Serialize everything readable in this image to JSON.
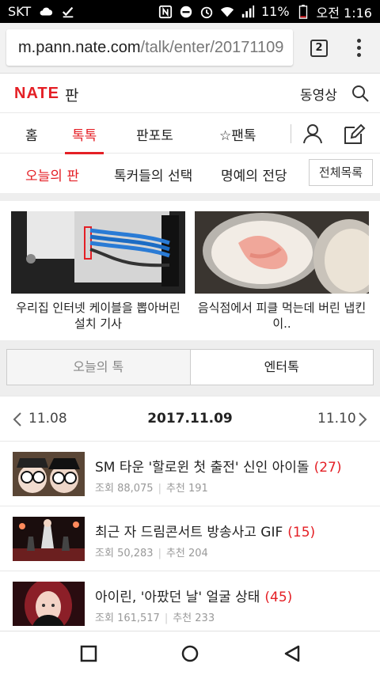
{
  "status_bar": {
    "carrier": "SKT",
    "battery": "11%",
    "time": "오전 1:16"
  },
  "browser": {
    "url_host": "m.pann.nate.com",
    "url_path": "/talk/enter/20171109",
    "tab_count": "2"
  },
  "header": {
    "logo": "NATE",
    "logo_sub": "판",
    "video_label": "동영상"
  },
  "main_nav": {
    "items": [
      "홈",
      "톡톡",
      "판포토",
      "☆팬톡"
    ],
    "active": "톡톡"
  },
  "sub_nav": {
    "items": [
      "오늘의 판",
      "톡커들의 선택",
      "명예의 전당"
    ],
    "all_button": "전체목록"
  },
  "featured": [
    {
      "caption": "우리집 인터넷 케이블을 뽑아버린 설치 기사"
    },
    {
      "caption": "음식점에서 피클 먹는데 버린 냅킨이.."
    }
  ],
  "toggle": {
    "off_label": "오늘의 톡",
    "on_label": "엔터톡"
  },
  "date_nav": {
    "prev": "11.08",
    "current": "2017.11.09",
    "next": "11.10"
  },
  "list": [
    {
      "title": "SM 타운 '할로윈 첫 출전' 신인 아이돌",
      "count": "(27)",
      "views_label": "조회",
      "views": "88,075",
      "rec_label": "추천",
      "rec": "191"
    },
    {
      "title": "최근 자 드림콘서트 방송사고 GIF",
      "count": "(15)",
      "views_label": "조회",
      "views": "50,283",
      "rec_label": "추천",
      "rec": "204"
    },
    {
      "title": "아이린, '아팠던 날' 얼굴 상태",
      "count": "(45)",
      "views_label": "조회",
      "views": "161,517",
      "rec_label": "추천",
      "rec": "233"
    }
  ],
  "colors": {
    "accent": "#e41f25",
    "gray_bg": "#eeeeee"
  }
}
